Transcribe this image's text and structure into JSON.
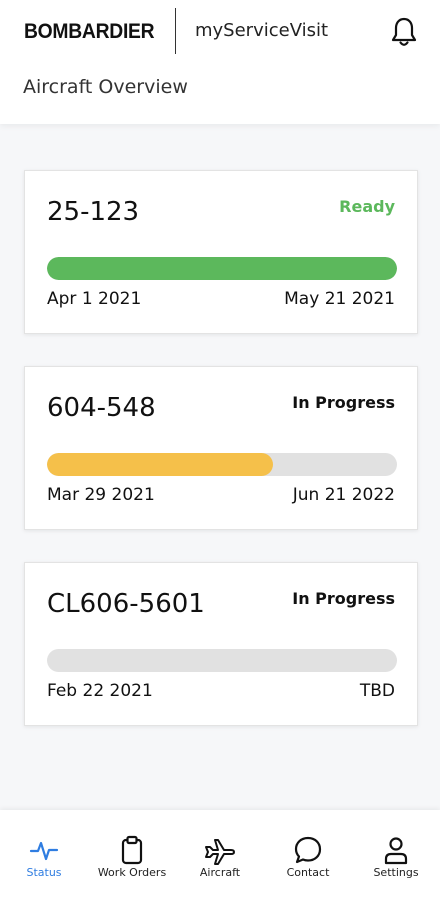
{
  "header": {
    "brand": "BOMBARDIER",
    "app_title": "myServiceVisit",
    "page_title": "Aircraft Overview"
  },
  "icons": {
    "notifications": "bell-icon"
  },
  "colors": {
    "accent": "#2f7de1",
    "ready": "#5cb85c",
    "complete_bar": "#5cb85c",
    "in_progress_bar": "#f5c04a",
    "track": "#e1e1e1"
  },
  "cards": [
    {
      "title": "25-123",
      "status": "Ready",
      "progress": 1.0,
      "start_date": "Apr 1 2021",
      "end_date": "May 21 2021"
    },
    {
      "title": "604-548",
      "status": "In Progress",
      "progress": 0.645,
      "start_date": "Mar 29 2021",
      "end_date": "Jun 21 2022"
    },
    {
      "title": "CL606-5601",
      "status": "In Progress",
      "progress": 0,
      "start_date": "Feb 22 2021",
      "end_date": "TBD"
    }
  ],
  "nav": {
    "items": [
      {
        "label": "Status",
        "icon": "activity-icon",
        "active": true
      },
      {
        "label": "Work Orders",
        "icon": "clipboard-icon",
        "active": false
      },
      {
        "label": "Aircraft",
        "icon": "plane-icon",
        "active": false
      },
      {
        "label": "Contact",
        "icon": "chat-icon",
        "active": false
      },
      {
        "label": "Settings",
        "icon": "user-icon",
        "active": false
      }
    ]
  }
}
